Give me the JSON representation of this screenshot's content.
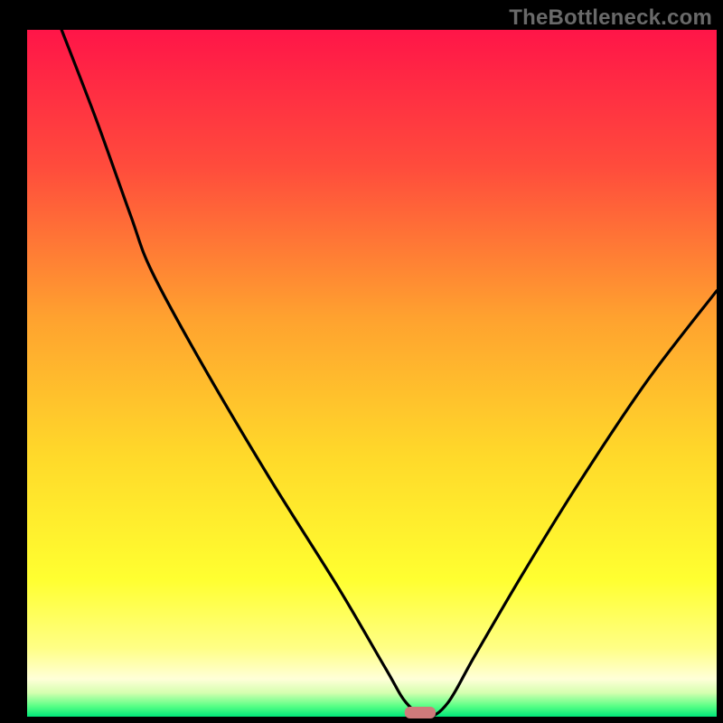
{
  "watermark": "TheBottleneck.com",
  "plot": {
    "inner": {
      "x0": 30,
      "y0": 33,
      "x1": 793,
      "y1": 793
    },
    "gradient_stops": [
      {
        "offset": 0.0,
        "color": "#ff1548"
      },
      {
        "offset": 0.2,
        "color": "#ff4c3c"
      },
      {
        "offset": 0.42,
        "color": "#ffa22f"
      },
      {
        "offset": 0.62,
        "color": "#ffd92a"
      },
      {
        "offset": 0.8,
        "color": "#ffff30"
      },
      {
        "offset": 0.9,
        "color": "#ffff85"
      },
      {
        "offset": 0.945,
        "color": "#ffffd8"
      },
      {
        "offset": 0.965,
        "color": "#d6ffb0"
      },
      {
        "offset": 0.985,
        "color": "#57ff85"
      },
      {
        "offset": 1.0,
        "color": "#00e77a"
      }
    ]
  },
  "chart_data": {
    "type": "line",
    "title": "",
    "xlabel": "",
    "ylabel": "",
    "x_range": [
      0,
      100
    ],
    "y_range": [
      0,
      100
    ],
    "ylim": [
      0,
      100
    ],
    "series": [
      {
        "name": "bottleneck-curve",
        "x": [
          5,
          10,
          15,
          18,
          25,
          35,
          45,
          52,
          55,
          58,
          61,
          65,
          72,
          80,
          90,
          100
        ],
        "y": [
          100,
          87,
          73,
          65,
          52,
          35,
          19,
          7,
          2,
          0,
          2,
          9,
          21,
          34,
          49,
          62
        ]
      }
    ],
    "marker": {
      "x": 57,
      "y": 0,
      "width_pct": 4.5,
      "label": "optimal-point"
    }
  }
}
